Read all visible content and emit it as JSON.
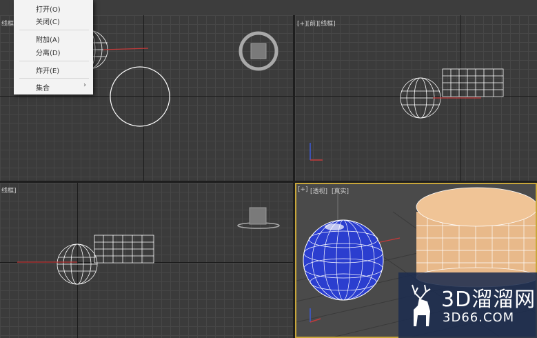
{
  "menu": {
    "items": [
      {
        "label": "打开(O)"
      },
      {
        "label": "关闭(C)"
      },
      {
        "label": "附加(A)"
      },
      {
        "label": "分离(D)"
      },
      {
        "label": "炸开(E)"
      },
      {
        "label": "集合",
        "submenu_arrow": "›"
      }
    ]
  },
  "viewports": {
    "top_left": {
      "label": "线框]"
    },
    "top_right": {
      "label": "[+][前][线框]"
    },
    "bottom_left": {
      "label": "线框]"
    },
    "bottom_right": {
      "label_plus": "[+]",
      "label_persp": "[透视]",
      "label_shading": "[真实]"
    }
  },
  "watermark": {
    "title": "3D溜溜网",
    "url": "3D66.COM"
  },
  "colors": {
    "active_viewport_border": "#c9a73a",
    "sphere_blue": "#2b3ecf",
    "cylinder": "#e8b98a"
  }
}
